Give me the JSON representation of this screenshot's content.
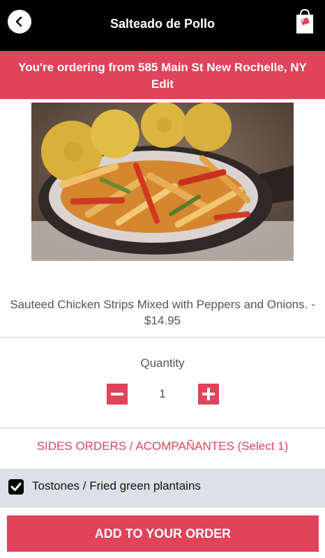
{
  "header": {
    "title": "Salteado de Pollo",
    "back_icon": "chevron-left-icon",
    "bag_icon": "shopping-bag-icon"
  },
  "banner": {
    "text": "You're ordering from 585 Main St New Rochelle, NY",
    "edit_label": "Edit"
  },
  "item": {
    "description": "Sauteed Chicken Strips Mixed with Peppers and Onions. - $14.95"
  },
  "quantity": {
    "label": "Quantity",
    "value": "1",
    "minus_icon": "minus-icon",
    "plus_icon": "plus-icon"
  },
  "sides": {
    "header": "SIDES ORDERS / ACOMPAÑANTES (Select 1)",
    "options": [
      {
        "label": "Tostones / Fried green plantains",
        "checked": true
      }
    ]
  },
  "footer": {
    "add_label": "ADD TO YOUR ORDER"
  },
  "colors": {
    "accent": "#e0435a",
    "topbar": "#000000",
    "option_bg": "#dae2e6"
  }
}
